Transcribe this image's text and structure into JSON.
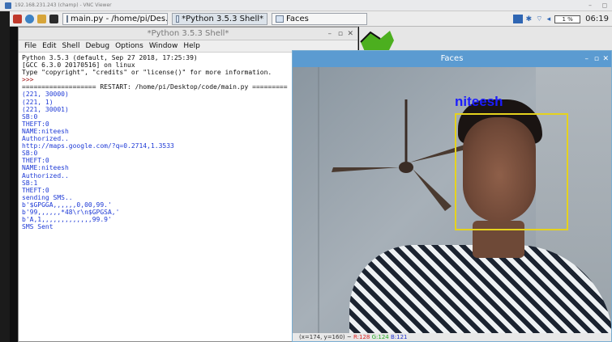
{
  "vnc": {
    "title": "192.168.231.243 (champ) - VNC Viewer"
  },
  "taskbar": {
    "buttons": [
      {
        "label": "main.py - /home/pi/Des..."
      },
      {
        "label": "*Python 3.5.3 Shell*"
      },
      {
        "label": "Faces"
      }
    ],
    "cpu": "1 %",
    "time": "06:19"
  },
  "shell": {
    "title": "*Python 3.5.3 Shell*",
    "menu": [
      "File",
      "Edit",
      "Shell",
      "Debug",
      "Options",
      "Window",
      "Help"
    ],
    "lines": [
      {
        "text": "Python 3.5.3 (default, Sep 27 2018, 17:25:39)",
        "style": "black"
      },
      {
        "text": "[GCC 6.3.0 20170516] on linux",
        "style": "black"
      },
      {
        "text": "Type \"copyright\", \"credits\" or \"license()\" for more information.",
        "style": "black"
      },
      {
        "text": ">>>",
        "style": "prompt"
      },
      {
        "text": "=================== RESTART: /home/pi/Desktop/code/main.py =========",
        "style": "black"
      },
      {
        "text": "(221, 30000)",
        "style": "blue"
      },
      {
        "text": "(221, 1)",
        "style": "blue"
      },
      {
        "text": "(221, 30001)",
        "style": "blue"
      },
      {
        "text": "SB:0",
        "style": "blue"
      },
      {
        "text": "THEFT:0",
        "style": "blue"
      },
      {
        "text": "NAME:niteesh",
        "style": "blue"
      },
      {
        "text": "Authorized..",
        "style": "blue"
      },
      {
        "text": "http://maps.google.com/?q=0.2714,1.3533",
        "style": "blue"
      },
      {
        "text": "SB:0",
        "style": "blue"
      },
      {
        "text": "THEFT:0",
        "style": "blue"
      },
      {
        "text": "NAME:niteesh",
        "style": "blue"
      },
      {
        "text": "Authorized..",
        "style": "blue"
      },
      {
        "text": "SB:1",
        "style": "blue"
      },
      {
        "text": "THEFT:0",
        "style": "blue"
      },
      {
        "text": "sending SMS..",
        "style": "blue"
      },
      {
        "text": "b'$GPGGA,,,,,,0,00,99.'",
        "style": "blue"
      },
      {
        "text": "b'99,,,,,,*48\\r\\n$GPGSA,'",
        "style": "blue"
      },
      {
        "text": "b'A,1,,,,,,,,,,,,,99.9'",
        "style": "blue"
      },
      {
        "text": "SMS Sent",
        "style": "blue"
      }
    ]
  },
  "faces": {
    "title": "Faces",
    "label": "niteesh",
    "status_prefix": "(x=174, y=160) ~",
    "status_r": "R:128",
    "status_g": "G:124",
    "status_b": "B:121"
  }
}
